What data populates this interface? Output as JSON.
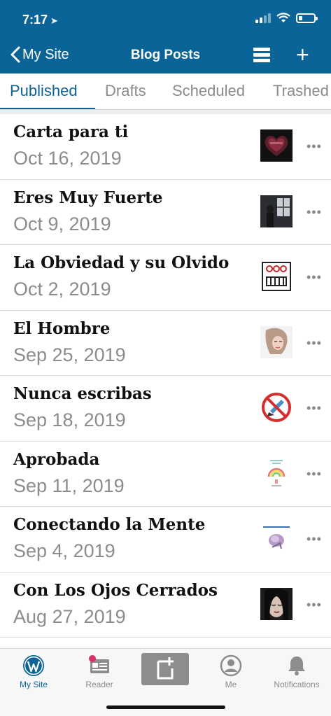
{
  "status_bar": {
    "time": "7:17",
    "location_arrow": "location-arrow-icon",
    "battery_percent": 25
  },
  "nav": {
    "back_label": "My Site",
    "title": "Blog Posts"
  },
  "tabs": [
    {
      "label": "Published",
      "active": true
    },
    {
      "label": "Drafts",
      "active": false
    },
    {
      "label": "Scheduled",
      "active": false
    },
    {
      "label": "Trashed",
      "active": false
    }
  ],
  "posts": [
    {
      "title": "Carta para ti",
      "date": "Oct 16, 2019",
      "thumb": "heart-collage-image"
    },
    {
      "title": "Eres Muy Fuerte",
      "date": "Oct 9, 2019",
      "thumb": "dark-room-figure-image"
    },
    {
      "title": "La Obviedad y su Olvido",
      "date": "Oct 2, 2019",
      "thumb": "robot-face-image"
    },
    {
      "title": "El Hombre",
      "date": "Sep 25, 2019",
      "thumb": "woman-portrait-image"
    },
    {
      "title": "Nunca escribas",
      "date": "Sep 18, 2019",
      "thumb": "no-writing-sign-image"
    },
    {
      "title": "Aprobada",
      "date": "Sep 11, 2019",
      "thumb": "rainbow-document-image"
    },
    {
      "title": "Conectando la Mente",
      "date": "Sep 4, 2019",
      "thumb": "brain-diagram-image"
    },
    {
      "title": "Con Los Ojos Cerrados",
      "date": "Aug 27, 2019",
      "thumb": "face-closed-eyes-image"
    }
  ],
  "more_label": "•••",
  "bottom_tabs": [
    {
      "label": "My Site",
      "icon": "wordpress-icon",
      "active": true
    },
    {
      "label": "Reader",
      "icon": "reader-icon",
      "active": false,
      "badge": true
    },
    {
      "label": "",
      "icon": "write-post-icon",
      "active": false
    },
    {
      "label": "Me",
      "icon": "profile-icon",
      "active": false
    },
    {
      "label": "Notifications",
      "icon": "bell-icon",
      "active": false
    }
  ],
  "colors": {
    "brand": "#0b6497",
    "badge": "#d6336c"
  }
}
